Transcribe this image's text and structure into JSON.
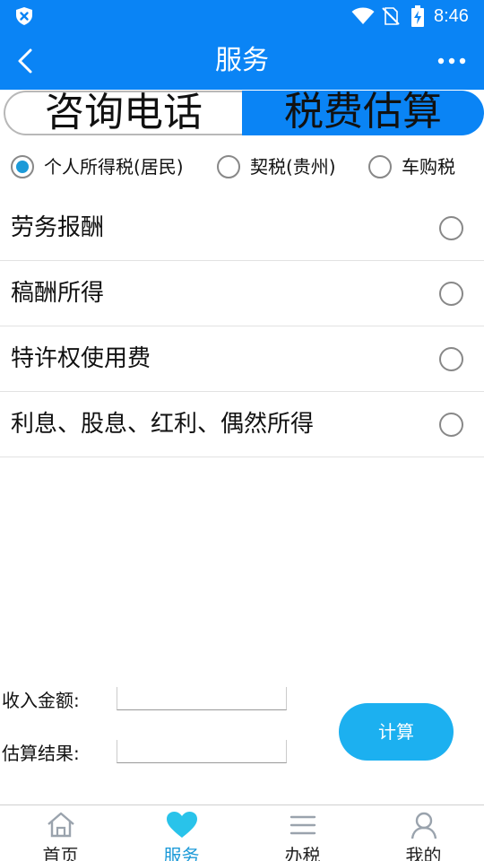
{
  "status_bar": {
    "time": "8:46"
  },
  "header": {
    "title": "服务"
  },
  "segment": {
    "left_label": "咨询电话",
    "right_label": "税费估算"
  },
  "tax_types": [
    {
      "label": "个人所得税(居民)",
      "selected": true
    },
    {
      "label": "契税(贵州)",
      "selected": false
    },
    {
      "label": "车购税",
      "selected": false
    }
  ],
  "income_items": [
    {
      "label": "劳务报酬"
    },
    {
      "label": "稿酬所得"
    },
    {
      "label": "特许权使用费"
    },
    {
      "label": "利息、股息、红利、偶然所得"
    }
  ],
  "form": {
    "income_label": "收入金额:",
    "income_value": "",
    "result_label": "估算结果:",
    "result_value": "",
    "calc_button": "计算"
  },
  "bottom_nav": [
    {
      "label": "首页",
      "icon": "home-icon",
      "active": false
    },
    {
      "label": "服务",
      "icon": "heart-icon",
      "active": true
    },
    {
      "label": "办税",
      "icon": "menu-icon",
      "active": false
    },
    {
      "label": "我的",
      "icon": "user-icon",
      "active": false
    }
  ],
  "colors": {
    "primary": "#0a84f5",
    "accent": "#1cb0f0",
    "radio_active": "#1c9ad8"
  }
}
